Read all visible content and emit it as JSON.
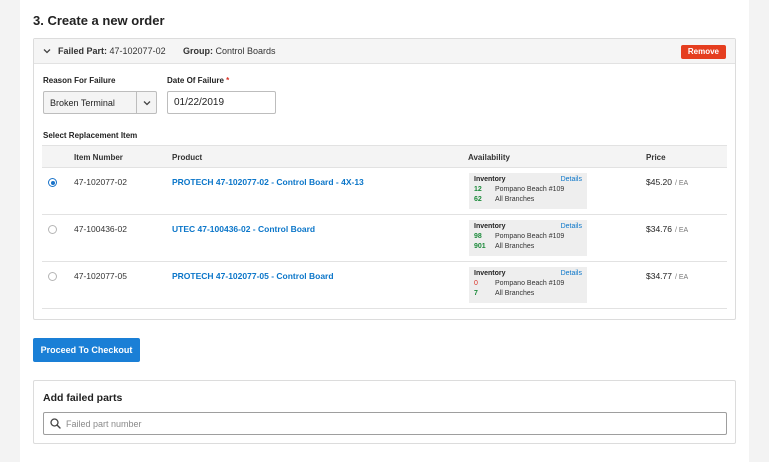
{
  "section": {
    "title": "3. Create a new order"
  },
  "order": {
    "failed_part_label": "Failed Part:",
    "failed_part_value": "47-102077-02",
    "group_label": "Group:",
    "group_value": "Control Boards",
    "remove_label": "Remove"
  },
  "form": {
    "reason_label": "Reason For Failure",
    "reason_value": "Broken Terminal",
    "date_label": "Date Of Failure",
    "date_required_mark": "*",
    "date_value": "01/22/2019"
  },
  "table": {
    "title": "Select Replacement Item",
    "headers": {
      "item_number": "Item Number",
      "product": "Product",
      "availability": "Availability",
      "price": "Price"
    },
    "rows": [
      {
        "item_number": "47-102077-02",
        "product": "PROTECH 47-102077-02 - Control Board - 4X-13",
        "inventory_label": "Inventory",
        "details_label": "Details",
        "qty_local": "12",
        "loc_local": "Pompano Beach #109",
        "qty_all": "62",
        "loc_all": "All Branches",
        "price": "$45.20",
        "unit": "/ EA"
      },
      {
        "item_number": "47-100436-02",
        "product": "UTEC 47-100436-02 - Control Board",
        "inventory_label": "Inventory",
        "details_label": "Details",
        "qty_local": "98",
        "loc_local": "Pompano Beach #109",
        "qty_all": "901",
        "loc_all": "All Branches",
        "price": "$34.76",
        "unit": "/ EA"
      },
      {
        "item_number": "47-102077-05",
        "product": "PROTECH 47-102077-05 - Control Board",
        "inventory_label": "Inventory",
        "details_label": "Details",
        "qty_local": "0",
        "loc_local": "Pompano Beach #109",
        "qty_all": "7",
        "loc_all": "All Branches",
        "price": "$34.77",
        "unit": "/ EA"
      }
    ]
  },
  "checkout": {
    "label": "Proceed To Checkout"
  },
  "add_parts": {
    "title": "Add failed parts",
    "placeholder": "Failed part number"
  },
  "colors": {
    "accent": "#1a7fd6",
    "link": "#0b76c9",
    "danger": "#e53e1f",
    "in_stock": "#1b8a3a",
    "out_of_stock": "#d93025"
  },
  "icons": {
    "collapse": "chevron-down-icon",
    "dropdown": "chevron-down-icon",
    "search": "search-icon"
  }
}
